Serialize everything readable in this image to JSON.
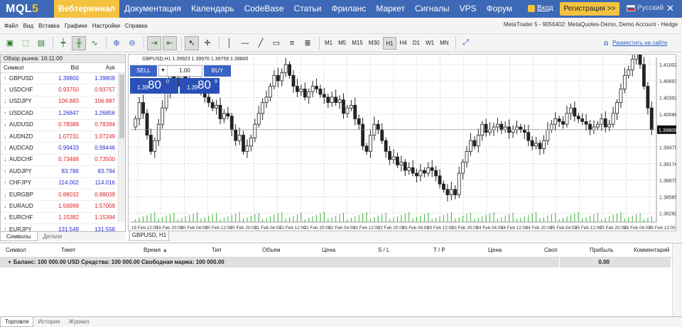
{
  "topnav": {
    "logo": "MQL",
    "logo_num": "5",
    "items": [
      "Вебтерминал",
      "Документация",
      "Календарь",
      "CodeBase",
      "Статьи",
      "Фриланс",
      "Маркет",
      "Сигналы",
      "VPS",
      "Форум"
    ],
    "login": "Вход",
    "register": "Регистрация >>",
    "lang": "Русский"
  },
  "menu": {
    "items": [
      "Файл",
      "Вид",
      "Вставка",
      "Графики",
      "Настройки",
      "Справка"
    ],
    "status": "MetaTrader 5 - 9056402: MetaQuotes-Demo, Demo Account - Hedge"
  },
  "toolbar": {
    "timeframes": [
      "M1",
      "M5",
      "M15",
      "M30",
      "H1",
      "H4",
      "D1",
      "W1",
      "MN"
    ],
    "selected_tf": "H1",
    "place_on_site": "Разместить на сайте"
  },
  "market_watch": {
    "title": "Обзор рынка: 16:11:00",
    "col_symbol": "Символ",
    "col_bid": "Bid",
    "col_ask": "Ask",
    "rows": [
      {
        "symbol": "GBPUSD",
        "bid": "1.39800",
        "ask": "1.39809",
        "dir": "up"
      },
      {
        "symbol": "USDCHF",
        "bid": "0.93750",
        "ask": "0.93757",
        "dir": "dn"
      },
      {
        "symbol": "USDJPY",
        "bid": "106.883",
        "ask": "106.887",
        "dir": "dn"
      },
      {
        "symbol": "USDCAD",
        "bid": "1.26847",
        "ask": "1.26856",
        "dir": "up"
      },
      {
        "symbol": "AUDUSD",
        "bid": "0.78389",
        "ask": "0.78394",
        "dir": "dn"
      },
      {
        "symbol": "AUDNZD",
        "bid": "1.07231",
        "ask": "1.07249",
        "dir": "dn"
      },
      {
        "symbol": "AUDCAD",
        "bid": "0.99433",
        "ask": "0.99446",
        "dir": "up"
      },
      {
        "symbol": "AUDCHF",
        "bid": "0.73488",
        "ask": "0.73500",
        "dir": "dn"
      },
      {
        "symbol": "AUDJPY",
        "bid": "83.786",
        "ask": "83.794",
        "dir": "up"
      },
      {
        "symbol": "CHFJPY",
        "bid": "114.002",
        "ask": "114.016",
        "dir": "up"
      },
      {
        "symbol": "EURGBP",
        "bid": "0.88032",
        "ask": "0.88039",
        "dir": "dn"
      },
      {
        "symbol": "EURAUD",
        "bid": "1.56999",
        "ask": "1.57009",
        "dir": "dn"
      },
      {
        "symbol": "EURCHF",
        "bid": "1.15382",
        "ask": "1.15394",
        "dir": "dn"
      },
      {
        "symbol": "EURJPY",
        "bid": "131.549",
        "ask": "131.558",
        "dir": "up"
      }
    ],
    "tabs": [
      "Символы",
      "Детали"
    ]
  },
  "chart": {
    "title": "GBPUSD,H1 1.39923 1.39970 1.39759 1.39800",
    "tab": "GBPUSD, H1",
    "sell_label": "SELL",
    "buy_label": "BUY",
    "lot": "1.00",
    "sell_price_pre": "1.39",
    "sell_price_big": "80",
    "sell_price_sup": "0",
    "buy_price_pre": "1.39",
    "buy_price_big": "80",
    "buy_price_sup": "9",
    "price_labels": [
      "1.41002",
      "1.40697",
      "1.40392",
      "1.40088",
      "1.39800",
      "1.39479",
      "1.39174",
      "1.38870",
      "1.38565",
      "1.38260"
    ],
    "current_price": "1.39800",
    "time_labels": [
      "19 Feb 12:00",
      "19 Feb 20:00",
      "20 Feb 04:00",
      "20 Feb 12:00",
      "20 Feb 20:00",
      "21 Feb 04:00",
      "21 Feb 12:00",
      "21 Feb 20:00",
      "22 Feb 04:00",
      "22 Feb 12:00",
      "22 Feb 20:00",
      "23 Feb 04:00",
      "23 Feb 12:00",
      "23 Feb 20:00",
      "24 Feb 04:00",
      "24 Feb 12:00",
      "24 Feb 20:00",
      "25 Feb 04:00",
      "25 Feb 12:00",
      "25 Feb 20:00",
      "26 Feb 04:00",
      "26 Feb 12:00"
    ]
  },
  "chart_data": {
    "type": "candlestick",
    "symbol": "GBPUSD",
    "timeframe": "H1",
    "ylim": [
      1.381,
      1.4113
    ],
    "grid": true,
    "close": [
      1.4,
      1.403,
      1.401,
      1.397,
      1.394,
      1.396,
      1.399,
      1.402,
      1.405,
      1.408,
      1.4075,
      1.406,
      1.408,
      1.407,
      1.4065,
      1.406,
      1.4062,
      1.4055,
      1.404,
      1.403,
      1.402,
      1.4025,
      1.4,
      1.401,
      1.4005,
      1.398,
      1.396,
      1.397,
      1.394,
      1.395,
      1.3965,
      1.399,
      1.401,
      1.403,
      1.404,
      1.406,
      1.408,
      1.407,
      1.4085,
      1.41,
      1.408,
      1.406,
      1.405,
      1.4055,
      1.404,
      1.405,
      1.406,
      1.4055,
      1.4045,
      1.404,
      1.403,
      1.404,
      1.403,
      1.4035,
      1.401,
      1.402,
      1.4025,
      1.4,
      1.399,
      1.395,
      1.394,
      1.397,
      1.399,
      1.398,
      1.396,
      1.394,
      1.3925,
      1.393,
      1.3915,
      1.392,
      1.3905,
      1.391,
      1.39,
      1.3895,
      1.3905,
      1.39,
      1.391,
      1.3905,
      1.3895,
      1.388,
      1.387,
      1.386,
      1.387,
      1.386,
      1.39,
      1.392,
      1.394,
      1.396,
      1.395,
      1.397,
      1.399,
      1.3975,
      1.398,
      1.3985,
      1.399,
      1.398,
      1.3985,
      1.3975,
      1.398,
      1.3985,
      1.398,
      1.3975,
      1.396,
      1.395,
      1.3955,
      1.3945,
      1.396,
      1.398,
      1.399,
      1.4,
      1.3995,
      1.399,
      1.401,
      1.402,
      1.4005,
      1.4,
      1.3995,
      1.399,
      1.398,
      1.3985,
      1.399,
      1.4,
      1.3985,
      1.399,
      1.401,
      1.403,
      1.4055,
      1.408,
      1.409,
      1.411,
      1.412,
      1.41,
      1.406,
      1.402,
      1.398
    ]
  },
  "terminal": {
    "columns": [
      "Символ",
      "Тикет",
      "Время",
      "Тип",
      "Объем",
      "Цена",
      "S / L",
      "T / P",
      "Цена",
      "Своп",
      "Прибыль",
      "Комментарий"
    ],
    "balance_text": "Баланс: 100 000.00 USD  Средства: 100 000.00  Свободная маржа: 100 000.00",
    "profit": "0.00",
    "tabs": [
      "Торговля",
      "История",
      "Журнал"
    ]
  }
}
